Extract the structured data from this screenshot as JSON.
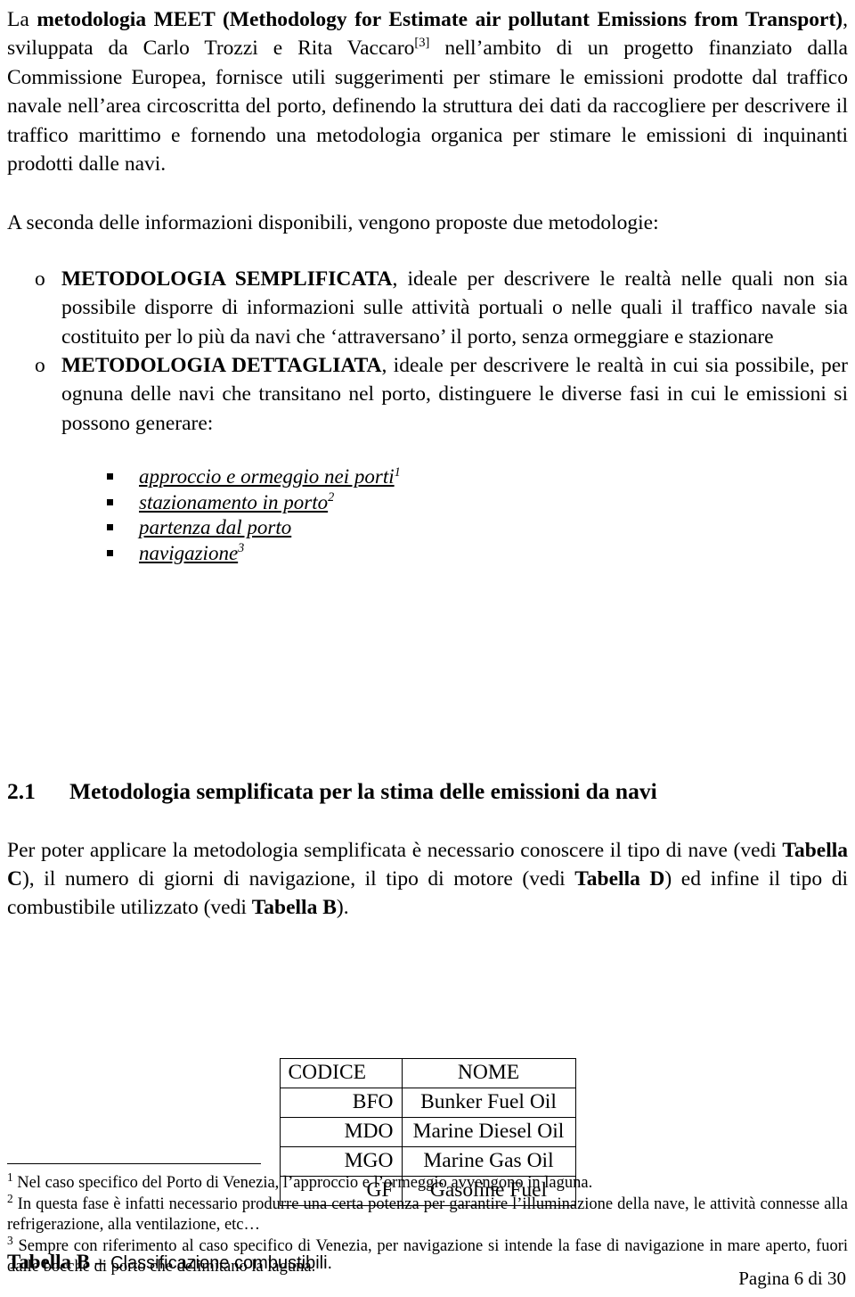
{
  "document": {
    "language": "it",
    "page_footer": "Pagina 6 di 30"
  },
  "intro": {
    "part1_prefix": "La ",
    "part1_bold": "metodologia MEET (Methodology for Estimate air pollutant Emissions from Transport)",
    "part1_suffix": ", sviluppata da Carlo Trozzi e Rita Vaccaro",
    "citation": "[3]",
    "part2": " nell’ambito di un progetto finanziato dalla Commissione Europea, fornisce utili suggerimenti per stimare le emissioni prodotte dal traffico navale nell’area circoscritta del porto, definendo la struttura dei dati da raccogliere per descrivere il traffico marittimo e fornendo una metodologia organica per stimare le emissioni di inquinanti prodotti dalle navi."
  },
  "lead_in": {
    "text": "A seconda delle informazioni disponibili, vengono proposte due metodologie:"
  },
  "methodologies": {
    "marker": "o",
    "items": [
      {
        "title": "METODOLOGIA SEMPLIFICATA",
        "body": ", ideale per descrivere le realtà nelle quali non sia possibile disporre di informazioni sulle attività portuali o nelle quali il traffico navale sia costituito per lo più da navi che ‘attraversano’ il porto, senza ormeggiare e stazionare"
      },
      {
        "title": "METODOLOGIA DETTAGLIATA",
        "body": ", ideale per descrivere le realtà in cui sia possibile, per ognuna delle navi che transitano nel porto, distinguere le diverse fasi in cui le emissioni si possono generare:"
      }
    ]
  },
  "phases": [
    {
      "label": "approccio e ormeggio nei porti",
      "note": "1"
    },
    {
      "label": "stazionamento in porto",
      "note": "2"
    },
    {
      "label": "partenza dal porto",
      "note": ""
    },
    {
      "label": "navigazione",
      "note": "3"
    }
  ],
  "section": {
    "number": "2.1",
    "title": "Metodologia semplificata per la stima delle emissioni da navi",
    "paragraph": {
      "seg1": "Per poter applicare la metodologia semplificata è necessario conoscere il tipo di nave (vedi ",
      "ref1": "Tabella C",
      "seg2": "), il numero di giorni di navigazione, il tipo di motore (vedi ",
      "ref2": "Tabella D",
      "seg3": ") ed infine il tipo di combustibile utilizzato (vedi ",
      "ref3": "Tabella B",
      "seg4": ")."
    }
  },
  "fuel_table": {
    "headers": {
      "code": "CODICE",
      "name": "NOME"
    },
    "rows": [
      {
        "code": "BFO",
        "name": "Bunker Fuel Oil"
      },
      {
        "code": "MDO",
        "name": "Marine Diesel Oil"
      },
      {
        "code": "MGO",
        "name": "Marine Gas Oil"
      },
      {
        "code": "GF",
        "name": "Gasoline Fuel"
      }
    ],
    "caption_strong": "Tabella B – ",
    "caption_rest": "Classificazione combustibili."
  },
  "footnotes": [
    {
      "marker": "1",
      "text": " Nel caso specifico del Porto di Venezia, l’approccio e l’ormeggio avvengono in laguna."
    },
    {
      "marker": "2",
      "text": " In questa fase è infatti necessario produrre una certa potenza per garantire l’illuminazione della nave, le attività connesse alla refrigerazione, alla ventilazione, etc…"
    },
    {
      "marker": "3",
      "text": " Sempre con riferimento al caso specifico di Venezia, per navigazione si intende la fase di navigazione in mare aperto, fuori dalle bocche di porto che delimitano la laguna."
    }
  ]
}
